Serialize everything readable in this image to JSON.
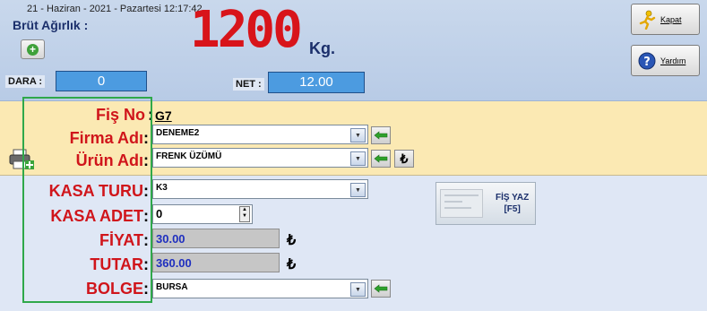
{
  "header": {
    "datetime": "21 - Haziran - 2021 - Pazartesi   12:17:42",
    "weight_label": "Brüt Ağırlık :",
    "weight_value": "1200",
    "weight_unit": "Kg.",
    "dara_label": "DARA :",
    "dara_value": "0",
    "net_label": "NET :",
    "net_value": "12.00",
    "kapat_label": "Kapat",
    "yardim_label": "Yardım"
  },
  "form": {
    "fis_no_label": "Fiş No",
    "fis_no_value": "G7",
    "firma_label": "Firma Adı",
    "firma_value": "DENEME2",
    "urun_label": "Ürün Adı",
    "urun_value": "FRENK ÜZÜMÜ",
    "kasa_turu_label": "KASA TURU",
    "kasa_turu_value": "K3",
    "kasa_adet_label": "KASA ADET",
    "kasa_adet_value": "0",
    "fiyat_label": "FİYAT",
    "fiyat_value": "30.00",
    "tutar_label": "TUTAR",
    "tutar_value": "360.00",
    "bolge_label": "BOLGE",
    "bolge_value": "BURSA",
    "currency_symbol": "₺",
    "colon": ":"
  },
  "fis_button": {
    "line1": "FİŞ YAZ",
    "line2": "[F5]"
  },
  "icons": {
    "add": "plus-icon",
    "kapat": "running-man-icon",
    "yardim": "help-icon",
    "arrow": "green-left-arrow-icon",
    "printer": "printer-add-icon",
    "dropdown": "chevron-down-icon"
  },
  "colors": {
    "weight_red": "#d8141a",
    "label_red": "#d0151b",
    "field_blue": "#4c9be0",
    "yellow_band": "#fbe9b3",
    "highlight_green": "#2fa84a"
  }
}
